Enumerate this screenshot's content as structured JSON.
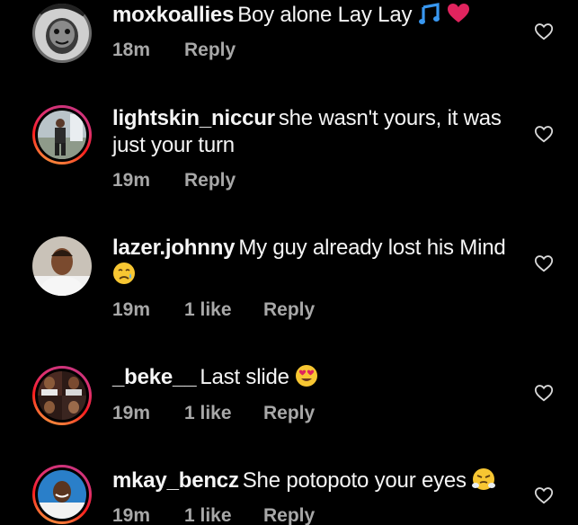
{
  "comments": [
    {
      "username": "moxkoallies",
      "text": "Boy alone Lay Lay",
      "emojis": [
        "music-note-emoji",
        "red-heart-emoji"
      ],
      "time": "18m",
      "likes": "",
      "reply": "Reply",
      "ring": false
    },
    {
      "username": "lightskin_niccur",
      "text": "she wasn't yours, it was just your turn",
      "emojis": [],
      "time": "19m",
      "likes": "",
      "reply": "Reply",
      "ring": true
    },
    {
      "username": "lazer.johnny",
      "text": "My guy already lost his Mind",
      "emojis": [
        "disappointed-relieved-emoji"
      ],
      "time": "19m",
      "likes": "1 like",
      "reply": "Reply",
      "ring": false
    },
    {
      "username": "_beke__",
      "text": "Last slide",
      "emojis": [
        "heart-eyes-emoji"
      ],
      "time": "19m",
      "likes": "1 like",
      "reply": "Reply",
      "ring": true
    },
    {
      "username": "mkay_bencz",
      "text": "She potopoto your eyes",
      "emojis": [
        "triumph-emoji"
      ],
      "time": "19m",
      "likes": "1 like",
      "reply": "Reply",
      "ring": true
    }
  ],
  "colors": {
    "background": "#000000",
    "text": "#f5f5f5",
    "meta": "#a8a8a8",
    "music_note": "#3897f0",
    "heart_emoji": "#e0245e"
  },
  "icons": {
    "like": "heart-outline-icon"
  }
}
